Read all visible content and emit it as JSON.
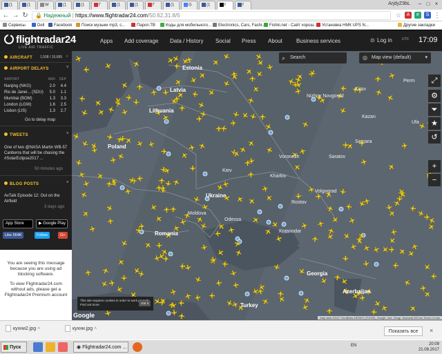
{
  "browser": {
    "tabs": [
      "(1",
      "(1",
      "W",
      "(1",
      "(1",
      "Г",
      "(1",
      "(1",
      "Г",
      "(1",
      "G",
      "(1",
      "f",
      "f"
    ],
    "user_chip": "ArjdyZ9bL",
    "omnibox": {
      "secure_label": "Надежный",
      "host": "https://www.flightradar24.com",
      "path": "/50.62,31.8/5"
    },
    "bookmarks": [
      "Сервисы",
      "Dell",
      "Facebook",
      "Поиск музыки mp3, с...",
      "Пароп.TB",
      "Коды для мобильного...",
      "Electronics, Cars, Fashi...",
      "Fishki.net - Сайт хорош...",
      "Установка НМК UPS N...",
      "Другие закладки"
    ]
  },
  "header": {
    "logo": "flightradar24",
    "tagline": "LIVE AIR TRAFFIC",
    "nav": [
      "Apps",
      "Add coverage",
      "Data / History",
      "Social",
      "Press",
      "About",
      "Business services"
    ],
    "login": "Log in",
    "utc_label": "UTC",
    "clock": "17:09"
  },
  "sidebar": {
    "aircraft_title": "AIRCRAFT",
    "aircraft_count": "1,508 / 15,695",
    "delays_title": "AIRPORT DELAYS",
    "delay_headers": {
      "airport": "AIRPORT",
      "arr": "ARR",
      "dep": "DEP"
    },
    "delays": [
      {
        "airport": "Nanjing (NKG)",
        "arr": "2.0",
        "dep": "4.4"
      },
      {
        "airport": "Rio de Janei... (SDU)",
        "arr": "5.0",
        "dep": "1.1"
      },
      {
        "airport": "Mumbai (BOM)",
        "arr": "1.3",
        "dep": "3.3"
      },
      {
        "airport": "London (LGW)",
        "arr": "1.6",
        "dep": "2.5"
      },
      {
        "airport": "Lisbon (LIS)",
        "arr": "1.3",
        "dep": "2.7"
      }
    ],
    "delay_link": "Go to delay map",
    "tweets_title": "TWEETS",
    "tweet": "One of two @NASA Martin WB-57 Canberra that will be chasing the #SolarEclipse2017 ...",
    "tweet_time": "50 minutes ago",
    "blog_title": "BLOG POSTS",
    "blog_post": "AvTalk Episode 12: Out on the Airfield",
    "blog_time": "3 days ago",
    "app_store": "App Store",
    "google_play": "Google Play",
    "fb_like": "Like 564K",
    "follow": "Follow",
    "gplus": "G+",
    "adblock_text": "You are seeing this message because you are using ad blocking software.",
    "adblock_text2": "To view Flightradar24.com without ads, please get a Flightradar24 Premium account"
  },
  "map": {
    "search_placeholder": "Search",
    "map_view": "Map view (default)",
    "labels": {
      "estonia": "Estonia",
      "latvia": "Latvia",
      "lithuania": "Lithuania",
      "poland": "Poland",
      "ukraine": "Ukraine",
      "romania": "Romania",
      "moldova": "Moldova",
      "odessa": "Odessa",
      "kiev": "Kiev",
      "kharkiv": "Kharkiv",
      "georgia": "Georgia",
      "azerbaijan": "Azerbaijan",
      "turkey": "Turkey",
      "kirov": "Kirov",
      "perm": "Perm",
      "kazan": "Kazan",
      "samara": "Samara",
      "saratov": "Saratov",
      "volgograd": "Volgograd",
      "ufa": "Ufa",
      "nizhny": "Nizhny Novgorod",
      "krasnodar": "Krasnodar",
      "rostov": "Rostov",
      "voronezh": "Voronezh"
    },
    "cookie_text": "This site requires cookies in order to work properly. Find out more",
    "cookie_button": "Got it",
    "google": "Google",
    "attribution": "Map data ©2017 GeoBasis-DE/BKG (©2009), Google, Inst. Geogr. Nacional   500 km   Terms of Use",
    "airplane_color": "#f6d21b"
  },
  "downloads": [
    {
      "name": "кухни2.jpg"
    },
    {
      "name": "кухни.jpg"
    }
  ],
  "show_all": "Показать все",
  "taskbar": {
    "start": "Пуск",
    "tasks": [
      "Flightradar24.com ..."
    ],
    "lang": "EN",
    "time": "20:09",
    "date": "21.08.2017"
  }
}
